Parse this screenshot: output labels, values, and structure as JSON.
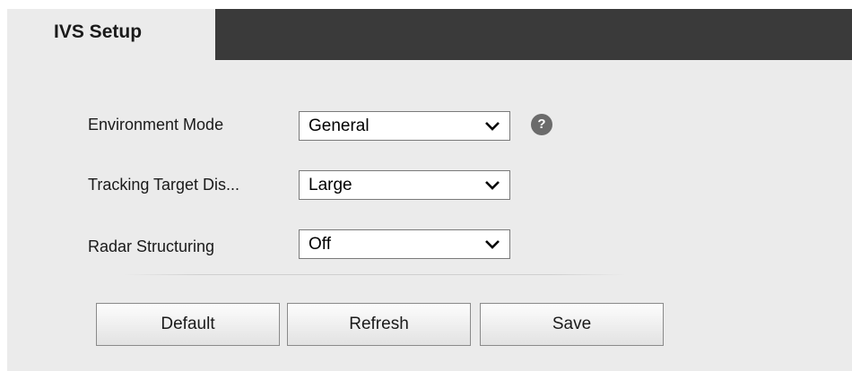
{
  "tab": {
    "label": "IVS Setup"
  },
  "form": {
    "rows": [
      {
        "label": "Environment Mode",
        "value": "General"
      },
      {
        "label": "Tracking Target Dis...",
        "value": "Large"
      },
      {
        "label": "Radar Structuring",
        "value": "Off"
      }
    ],
    "help_icon": {
      "glyph": "?",
      "icon": "help-icon"
    }
  },
  "buttons": {
    "default_label": "Default",
    "refresh_label": "Refresh",
    "save_label": "Save"
  },
  "colors": {
    "panel_bg": "#ebebeb",
    "tabbar_bg": "#3a3a3a",
    "help_icon_bg": "#6b6b6b"
  }
}
